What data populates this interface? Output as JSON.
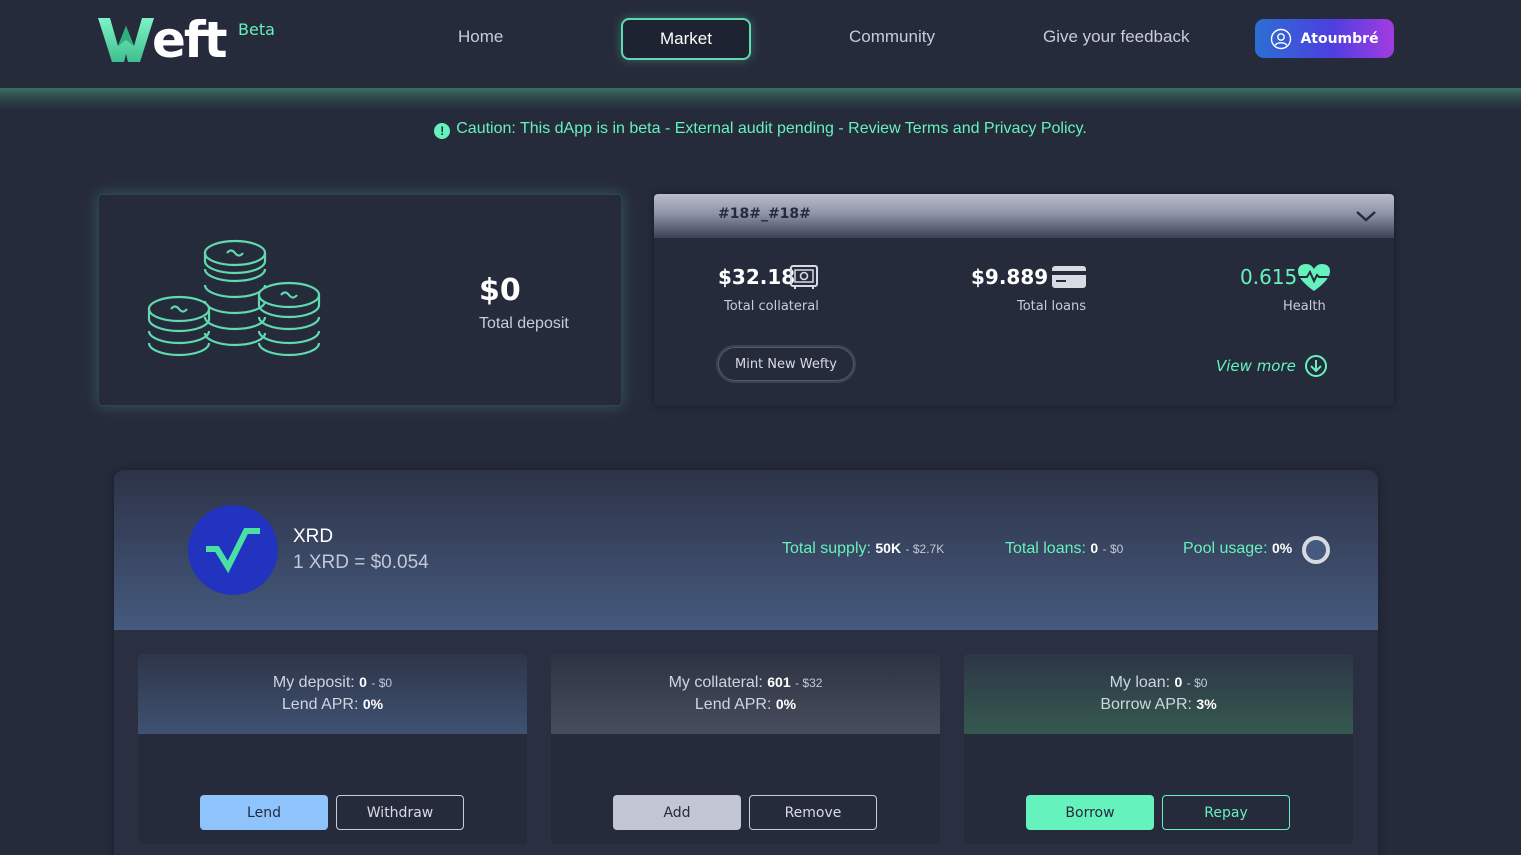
{
  "header": {
    "logo_text": "eft",
    "beta": "Beta",
    "nav": [
      {
        "label": "Home"
      },
      {
        "label": "Market"
      },
      {
        "label": "Community"
      },
      {
        "label": "Give your feedback"
      }
    ],
    "user": "Atoumbré"
  },
  "caution": "Caution: This dApp is in beta - External audit pending - Review Terms and Privacy Policy.",
  "deposit": {
    "value": "$0",
    "label": "Total deposit"
  },
  "wefty": {
    "id": "#18#_#18#",
    "collateral_value": "$32.18",
    "collateral_label": "Total collateral",
    "loans_value": "$9.889",
    "loans_label": "Total loans",
    "health_value": "0.615",
    "health_label": "Health",
    "mint_label": "Mint New Wefty",
    "view_more": "View more"
  },
  "market": {
    "token": "XRD",
    "price": "1 XRD = $0.054",
    "total_supply_label": "Total supply:",
    "total_supply": "50K",
    "total_supply_usd": "- $2.7K",
    "total_loans_label": "Total loans:",
    "total_loans": "0",
    "total_loans_usd": "- $0",
    "pool_usage_label": "Pool usage:",
    "pool_usage": "0%",
    "deposit_box": {
      "deposit_label": "My deposit:",
      "deposit_value": "0",
      "deposit_usd": "- $0",
      "apr_label": "Lend APR:",
      "apr_value": "0%",
      "btn1": "Lend",
      "btn2": "Withdraw"
    },
    "collateral_box": {
      "collateral_label": "My collateral:",
      "collateral_value": "601",
      "collateral_usd": "- $32",
      "apr_label": "Lend APR:",
      "apr_value": "0%",
      "btn1": "Add",
      "btn2": "Remove"
    },
    "loan_box": {
      "loan_label": "My loan:",
      "loan_value": "0",
      "loan_usd": "- $0",
      "apr_label": "Borrow APR:",
      "apr_value": "3%",
      "btn1": "Borrow",
      "btn2": "Repay"
    }
  },
  "colors": {
    "accent": "#66f2bd",
    "background": "#262b3c",
    "lend_button": "#8ec3fb",
    "add_button": "#c2c6d3",
    "borrow_button": "#66f2bd"
  }
}
